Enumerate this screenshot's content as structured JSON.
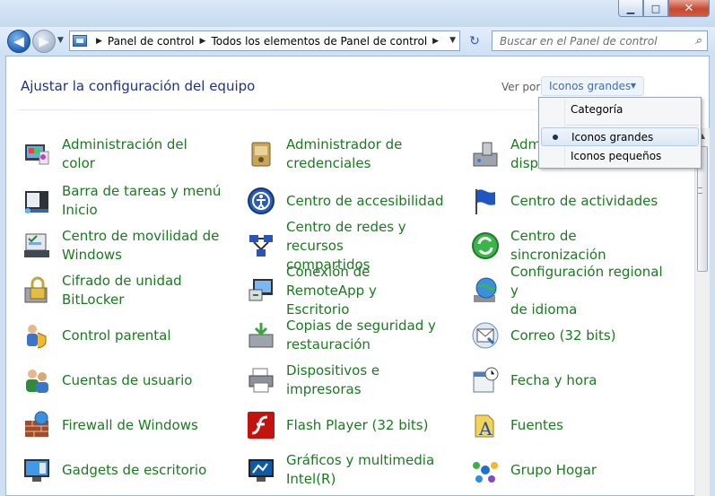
{
  "window": {
    "minimize_glyph": "▁",
    "maximize_glyph": "□",
    "close_glyph": "✕"
  },
  "nav": {
    "back_glyph": "◀",
    "forward_glyph": "▶",
    "history_glyph": "▼",
    "breadcrumbs": [
      "Panel de control",
      "Todos los elementos de Panel de control"
    ],
    "crumb_separator": "▶",
    "refresh_glyph": "↻",
    "search_placeholder": "Buscar en el Panel de control",
    "search_glyph": "⌕"
  },
  "header": {
    "title": "Ajustar la configuración del equipo",
    "view_by_label": "Ver por:",
    "view_by_value": "Iconos grandes"
  },
  "menu": {
    "options": [
      "Categoría",
      "Iconos grandes",
      "Iconos pequeños"
    ],
    "selected": "Iconos grandes"
  },
  "items": [
    {
      "label1": "Administración del color",
      "label2": "",
      "icon": "color-management-icon"
    },
    {
      "label1": "Administrador de",
      "label2": "credenciales",
      "icon": "credential-manager-icon"
    },
    {
      "label1": "Adm",
      "label2": "dispositivos",
      "icon": "device-manager-icon"
    },
    {
      "label1": "Barra de tareas y menú",
      "label2": "Inicio",
      "icon": "taskbar-start-icon"
    },
    {
      "label1": "Centro de accesibilidad",
      "label2": "",
      "icon": "accessibility-icon"
    },
    {
      "label1": "Centro de actividades",
      "label2": "",
      "icon": "action-center-flag-icon"
    },
    {
      "label1": "Centro de movilidad de",
      "label2": "Windows",
      "icon": "mobility-center-icon"
    },
    {
      "label1": "Centro de redes y recursos",
      "label2": "compartidos",
      "icon": "network-sharing-icon"
    },
    {
      "label1": "Centro de sincronización",
      "label2": "",
      "icon": "sync-center-icon"
    },
    {
      "label1": "Cifrado de unidad",
      "label2": "BitLocker",
      "icon": "bitlocker-icon"
    },
    {
      "label1": "Conexión de RemoteApp y",
      "label2": "Escritorio",
      "icon": "remoteapp-icon"
    },
    {
      "label1": "Configuración regional y",
      "label2": "de idioma",
      "icon": "region-language-globe-icon"
    },
    {
      "label1": "Control parental",
      "label2": "",
      "icon": "parental-control-icon"
    },
    {
      "label1": "Copias de seguridad y",
      "label2": "restauración",
      "icon": "backup-restore-icon"
    },
    {
      "label1": "Correo (32 bits)",
      "label2": "",
      "icon": "mail-icon"
    },
    {
      "label1": "Cuentas de usuario",
      "label2": "",
      "icon": "user-accounts-icon"
    },
    {
      "label1": "Dispositivos e impresoras",
      "label2": "",
      "icon": "devices-printers-icon"
    },
    {
      "label1": "Fecha y hora",
      "label2": "",
      "icon": "date-time-icon"
    },
    {
      "label1": "Firewall de Windows",
      "label2": "",
      "icon": "firewall-icon"
    },
    {
      "label1": "Flash Player (32 bits)",
      "label2": "",
      "icon": "flash-player-icon"
    },
    {
      "label1": "Fuentes",
      "label2": "",
      "icon": "fonts-icon"
    },
    {
      "label1": "Gadgets de escritorio",
      "label2": "",
      "icon": "desktop-gadgets-icon"
    },
    {
      "label1": "Gráficos y multimedia",
      "label2": "Intel(R)",
      "icon": "intel-graphics-icon"
    },
    {
      "label1": "Grupo Hogar",
      "label2": "",
      "icon": "homegroup-icon"
    }
  ],
  "colors": {
    "link_green": "#1a7a1f",
    "title_blue": "#1e3287",
    "accent_blue": "#3d6fb8"
  }
}
